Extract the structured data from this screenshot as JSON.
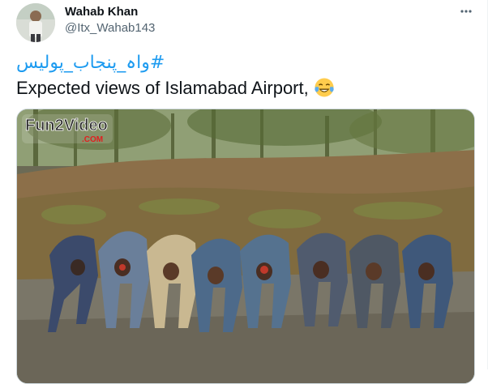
{
  "tweet": {
    "author": {
      "name": "Wahab Khan",
      "handle": "@Itx_Wahab143"
    },
    "hashtag": "#واہ_پنجاب_پولیس",
    "text": "Expected views of Islamabad Airport,",
    "emoji_icon": "face-with-tears-of-joy-emoji",
    "media": {
      "watermark_line1": "Fun2Video",
      "watermark_line2": ".COM"
    }
  },
  "colors": {
    "link": "#1d9bf0",
    "text": "#0f1419",
    "secondary": "#536471"
  }
}
